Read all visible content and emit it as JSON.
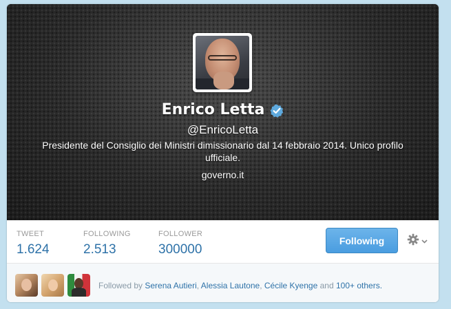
{
  "profile": {
    "name": "Enrico Letta",
    "handle": "@EnricoLetta",
    "bio": "Presidente del Consiglio dei Ministri dimissionario dal 14 febbraio 2014. Unico profilo ufficiale.",
    "url": "governo.it",
    "verified": true
  },
  "stats": [
    {
      "label": "TWEET",
      "value": "1.624"
    },
    {
      "label": "FOLLOWING",
      "value": "2.513"
    },
    {
      "label": "FOLLOWER",
      "value": "300000"
    }
  ],
  "actions": {
    "follow_label": "Following",
    "settings_icon": "gear-icon"
  },
  "followed_by": {
    "prefix": "Followed by",
    "names": [
      "Serena Autieri",
      "Alessia Lautone",
      "Cécile Kyenge"
    ],
    "sep": ",",
    "and": "and",
    "others": "100+ others."
  },
  "colors": {
    "background": "#c3e0ef",
    "link": "#2e72a8",
    "button": "#55a6e6",
    "verified": "#5ea9dd"
  }
}
